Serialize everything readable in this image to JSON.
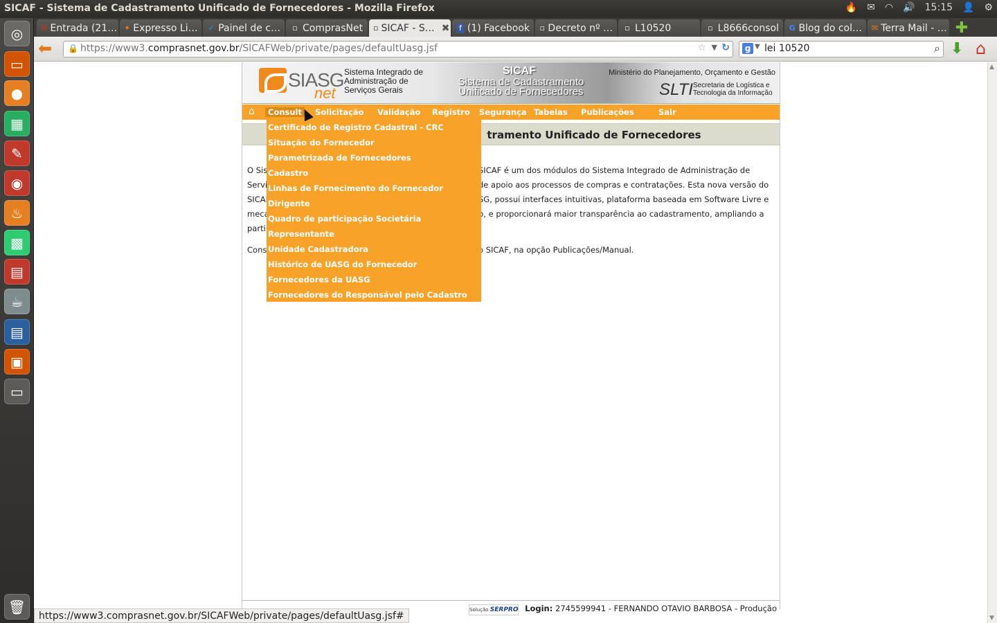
{
  "window": {
    "title": "SICAF - Sistema de Cadastramento Unificado de Fornecedores - Mozilla Firefox",
    "clock": "15:15"
  },
  "tabs": [
    {
      "label": "Entrada (21…",
      "icon": "gmail-icon",
      "color": "#c0392b"
    },
    {
      "label": "Expresso Li…",
      "icon": "expresso-icon",
      "color": "#e67e22"
    },
    {
      "label": "Painel de c…",
      "icon": "painel-icon",
      "color": "#2980b9"
    },
    {
      "label": "ComprasNet",
      "icon": "page-icon",
      "color": "#777777"
    },
    {
      "label": "SICAF - S…",
      "icon": "page-icon",
      "color": "#777777",
      "active": true
    },
    {
      "label": "(1) Facebook",
      "icon": "facebook-icon",
      "color": "#3b5998"
    },
    {
      "label": "Decreto nº …",
      "icon": "page-icon",
      "color": "#777777"
    },
    {
      "label": "L10520",
      "icon": "page-icon",
      "color": "#777777"
    },
    {
      "label": "L8666consol",
      "icon": "page-icon",
      "color": "#777777"
    },
    {
      "label": "Blog do col…",
      "icon": "google-icon",
      "color": "#4285f4"
    },
    {
      "label": "Terra Mail - …",
      "icon": "mail-icon",
      "color": "#e67e22"
    }
  ],
  "nav": {
    "url_prefix": "https://www3.",
    "url_host": "comprasnet.gov.br",
    "url_path": "/SICAFWeb/private/pages/defaultUasg.jsf",
    "search_value": "lei 10520"
  },
  "banner": {
    "siasg": "SIASG",
    "net": "net",
    "siasg_desc": "Sistema Integrado de\nAdministração de\nServiços Gerais",
    "sicaf_title": "SICAF",
    "sicaf_sub": "Sistema de Cadastramento\nUnificado de Fornecedores",
    "ministry": "Ministério do Planejamento, Orçamento e Gestão",
    "slti": "SLTI",
    "slti_desc": "Secretaria de Logística e\nTecnologia da Informação"
  },
  "menu": {
    "items": [
      "Consulta",
      "Solicitação",
      "Validação",
      "Registro",
      "Segurança",
      "Tabelas",
      "Publicações",
      "Sair"
    ],
    "visible_first": "Consult"
  },
  "dropdown": [
    "Certificado de Registro Cadastral - CRC",
    "Situação do Fornecedor",
    "Parametrizada de Fornecedores",
    "Cadastro",
    "Linhas de Fornecimento do Fornecedor",
    "Dirigente",
    "Quadro de participação Societária",
    "Representante",
    "Unidade Cadastradora",
    "Histórico de UASG do Fornecedor",
    "Fornecedores da UASG",
    "Fornecedores do Responsável pelo Cadastro"
  ],
  "page_header": "tramento Unificado de Fornecedores",
  "intro": {
    "lines_left": [
      "O Sis",
      "Servi",
      "SICAF",
      "meca",
      "parti"
    ],
    "lines_right": [
      "SICAF é um dos módulos do Sistema Integrado de Administração de",
      "de apoio aos processos de compras e contratações. Esta nova versão do",
      "SG, possui interfaces intuitivas, plataforma baseada em Software Livre e",
      "b, e proporcionará maior transparência ao cadastramento, ampliando a"
    ],
    "p2_left": "Cons",
    "p2_right": "o SICAF, na opção Publicações/Manual."
  },
  "footer": {
    "serpro_prefix": "Solução",
    "serpro": "SERPRO",
    "login_label": "Login:",
    "login_value": "2745599941 - FERNANDO OTAVIO BARBOSA - Produção"
  },
  "status": "https://www3.comprasnet.gov.br/SICAFWeb/private/pages/defaultUasg.jsf#"
}
